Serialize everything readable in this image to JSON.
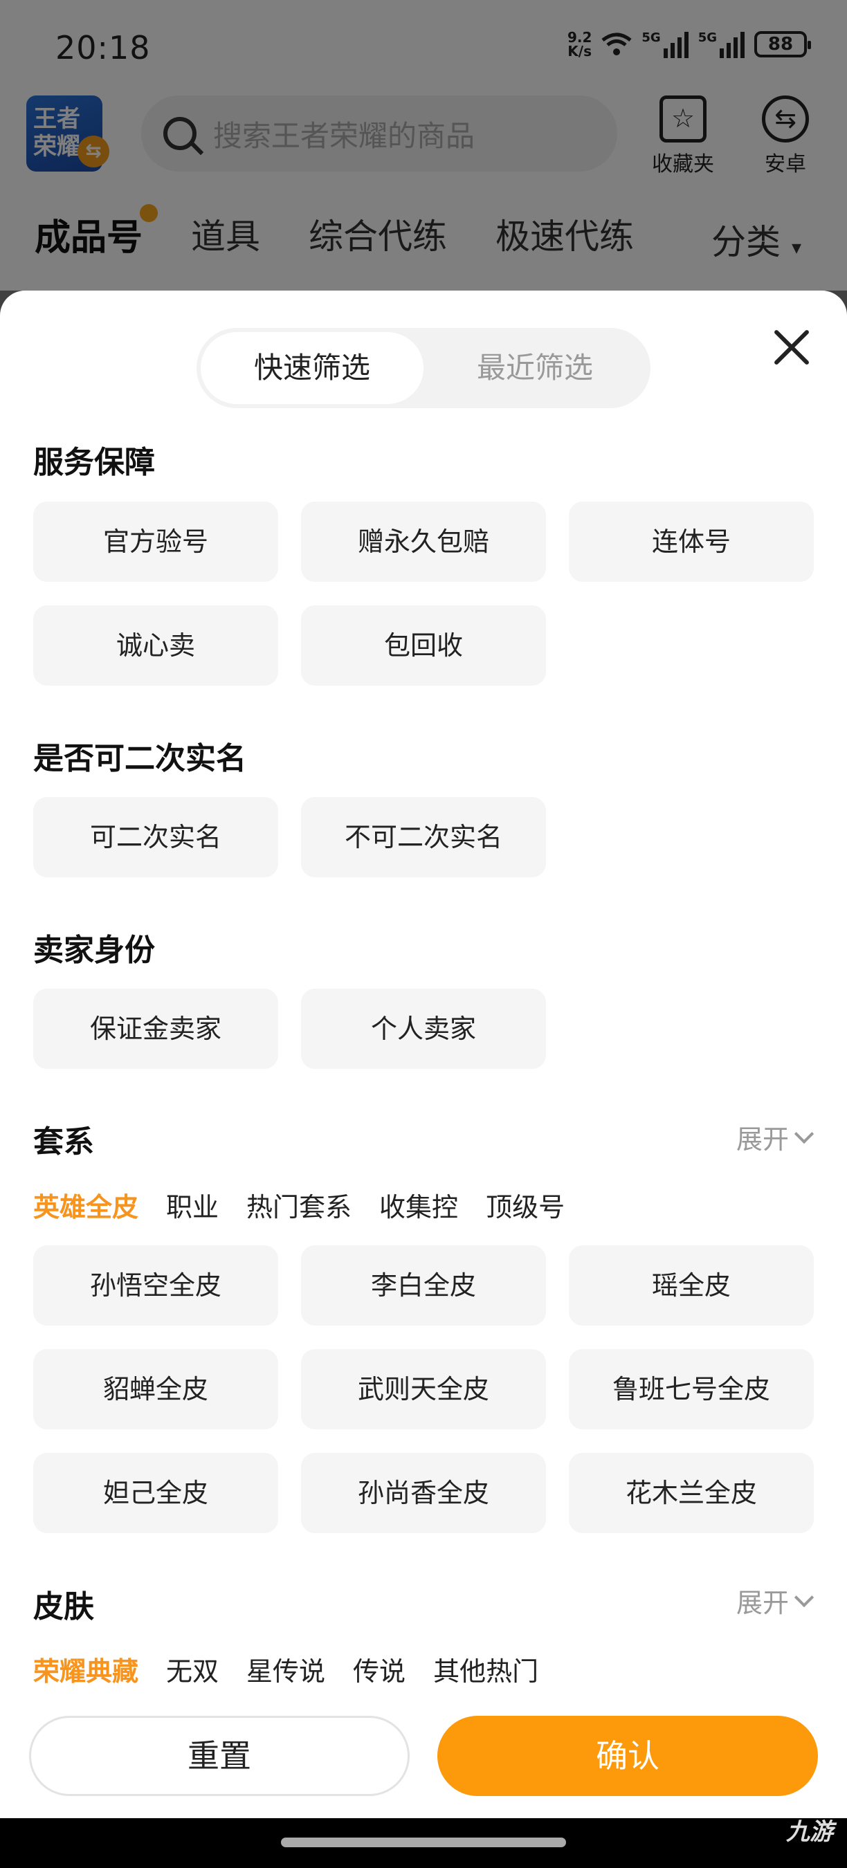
{
  "status_bar": {
    "time": "20:18",
    "net_speed": "9.2",
    "net_unit": "K/s",
    "sim1": "5G",
    "sim2": "5G",
    "battery": "88"
  },
  "app_header": {
    "logo_line1": "王者",
    "logo_line2": "荣耀",
    "search_placeholder": "搜索王者荣耀的商品",
    "favorites_label": "收藏夹",
    "platform_label": "安卓"
  },
  "category_tabs": {
    "items": [
      "成品号",
      "道具",
      "综合代练",
      "极速代练"
    ],
    "more_label": "分类"
  },
  "sheet": {
    "segment": {
      "quick": "快速筛选",
      "recent": "最近筛选"
    },
    "service": {
      "title": "服务保障",
      "options": [
        "官方验号",
        "赠永久包赔",
        "连体号",
        "诚心卖",
        "包回收"
      ]
    },
    "realname": {
      "title": "是否可二次实名",
      "options": [
        "可二次实名",
        "不可二次实名"
      ]
    },
    "seller": {
      "title": "卖家身份",
      "options": [
        "保证金卖家",
        "个人卖家"
      ]
    },
    "suite": {
      "title": "套系",
      "expand": "展开",
      "subtabs": [
        "英雄全皮",
        "职业",
        "热门套系",
        "收集控",
        "顶级号"
      ],
      "options": [
        "孙悟空全皮",
        "李白全皮",
        "瑶全皮",
        "貂蝉全皮",
        "武则天全皮",
        "鲁班七号全皮",
        "妲己全皮",
        "孙尚香全皮",
        "花木兰全皮"
      ]
    },
    "skin": {
      "title": "皮肤",
      "expand": "展开",
      "subtabs": [
        "荣耀典藏",
        "无双",
        "星传说",
        "传说",
        "其他热门"
      ]
    },
    "reset_label": "重置",
    "confirm_label": "确认"
  },
  "watermark": "九游"
}
